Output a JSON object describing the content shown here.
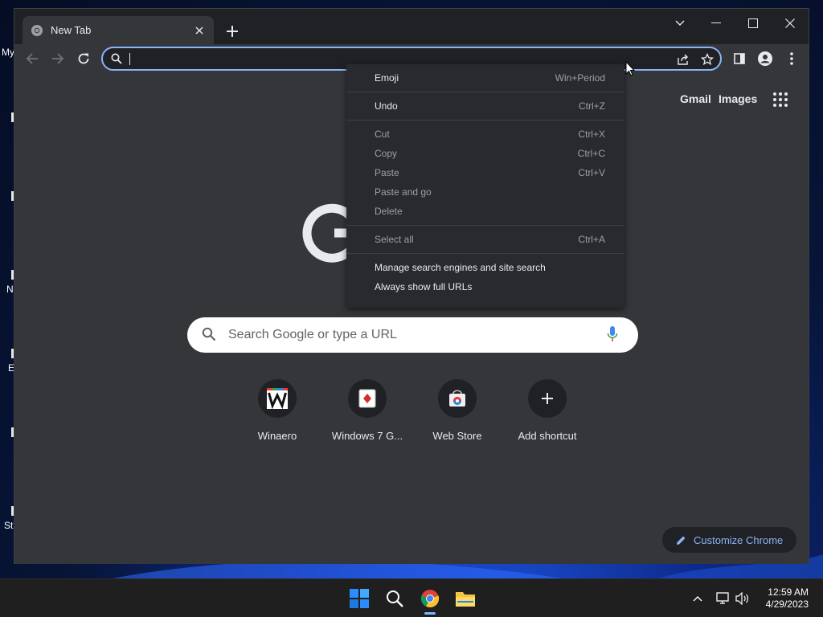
{
  "desktop": {
    "icon_labels": [
      "My",
      "N",
      "E",
      "Sti"
    ]
  },
  "browser": {
    "tab": {
      "title": "New Tab"
    },
    "omnibox": {
      "value": "",
      "placeholder": ""
    },
    "ntp": {
      "top_links": [
        "Gmail",
        "Images"
      ],
      "search_placeholder": "Search Google or type a URL",
      "shortcuts": [
        {
          "label": "Winaero",
          "icon": "winaero-icon"
        },
        {
          "label": "Windows 7 G...",
          "icon": "solitaire-card-icon"
        },
        {
          "label": "Web Store",
          "icon": "web-store-icon"
        },
        {
          "label": "Add shortcut",
          "icon": "plus-icon"
        }
      ],
      "customize_label": "Customize Chrome"
    }
  },
  "context_menu": {
    "items": [
      {
        "label": "Emoji",
        "shortcut": "Win+Period",
        "enabled": true
      },
      {
        "label": "Undo",
        "shortcut": "Ctrl+Z",
        "enabled": true
      },
      {
        "label": "Cut",
        "shortcut": "Ctrl+X",
        "enabled": false
      },
      {
        "label": "Copy",
        "shortcut": "Ctrl+C",
        "enabled": false
      },
      {
        "label": "Paste",
        "shortcut": "Ctrl+V",
        "enabled": false
      },
      {
        "label": "Paste and go",
        "shortcut": "",
        "enabled": false
      },
      {
        "label": "Delete",
        "shortcut": "",
        "enabled": false
      },
      {
        "label": "Select all",
        "shortcut": "Ctrl+A",
        "enabled": false
      },
      {
        "label": "Manage search engines and site search",
        "shortcut": "",
        "enabled": true
      },
      {
        "label": "Always show full URLs",
        "shortcut": "",
        "enabled": true
      }
    ]
  },
  "taskbar": {
    "apps": [
      "start-icon",
      "search-icon",
      "chrome-icon",
      "file-explorer-icon"
    ],
    "clock": {
      "time": "12:59 AM",
      "date": "4/29/2023"
    }
  },
  "colors": {
    "accent": "#8ab4f8",
    "window_bg": "#202124",
    "toolbar_bg": "#35363a",
    "menu_bg": "#292a2d"
  }
}
